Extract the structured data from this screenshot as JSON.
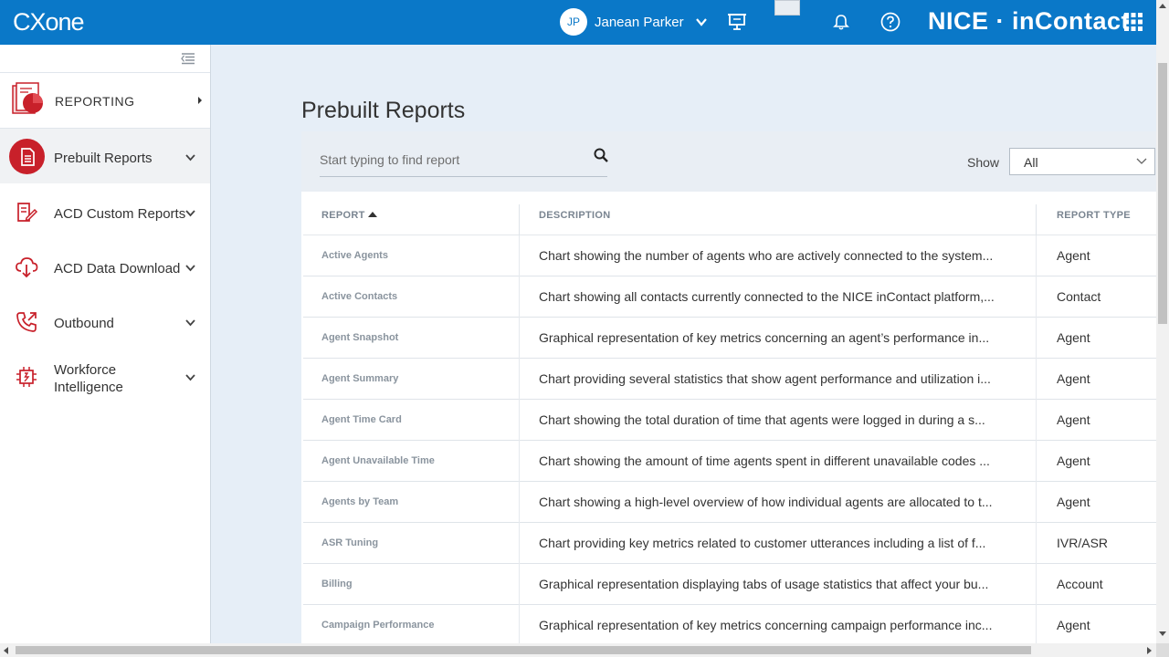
{
  "header": {
    "logo": "CXone",
    "user_initials": "JP",
    "user_name": "Janean Parker",
    "brand": "NICE · inContact",
    "icons": [
      "presentation-icon",
      "notification-bell-icon",
      "help-icon",
      "app-grid-icon"
    ]
  },
  "sidebar": {
    "module": "REPORTING",
    "items": [
      {
        "label": "Prebuilt Reports",
        "icon": "document-icon",
        "active": true
      },
      {
        "label": "ACD Custom Reports",
        "icon": "edit-document-icon"
      },
      {
        "label": "ACD Data Download",
        "icon": "cloud-download-icon"
      },
      {
        "label": "Outbound",
        "icon": "phone-outgoing-icon"
      },
      {
        "label": "Workforce Intelligence",
        "icon": "chip-icon"
      }
    ]
  },
  "main": {
    "title": "Prebuilt Reports",
    "search_placeholder": "Start typing to find report",
    "show_label": "Show",
    "show_value": "All",
    "columns": [
      "REPORT",
      "DESCRIPTION",
      "REPORT TYPE"
    ],
    "rows": [
      {
        "name": "Active Agents",
        "description": "Chart showing the number of agents who are actively connected to the system...",
        "type": "Agent"
      },
      {
        "name": "Active Contacts",
        "description": "Chart showing all contacts currently connected to the NICE inContact platform,...",
        "type": "Contact"
      },
      {
        "name": "Agent Snapshot",
        "description": "Graphical representation of key metrics concerning an agent’s performance in...",
        "type": "Agent"
      },
      {
        "name": "Agent Summary",
        "description": "Chart providing several statistics that show agent performance and utilization i...",
        "type": "Agent"
      },
      {
        "name": "Agent Time Card",
        "description": "Chart showing the total duration of time that agents were logged in during a s...",
        "type": "Agent"
      },
      {
        "name": "Agent Unavailable Time",
        "description": "Chart showing the amount of time agents spent in different unavailable codes ...",
        "type": "Agent"
      },
      {
        "name": "Agents by Team",
        "description": "Chart showing a high-level overview of how individual agents are allocated to t...",
        "type": "Agent"
      },
      {
        "name": "ASR Tuning",
        "description": "Chart providing key metrics related to customer utterances including a list of f...",
        "type": "IVR/ASR"
      },
      {
        "name": "Billing",
        "description": "Graphical representation displaying tabs of usage statistics that affect your bu...",
        "type": "Account"
      },
      {
        "name": "Campaign Performance",
        "description": "Graphical representation of key metrics concerning campaign performance inc...",
        "type": "Agent"
      }
    ]
  },
  "colors": {
    "header_blue": "#0a78c8",
    "accent_red": "#c8202a",
    "page_bg": "#e6eef7"
  }
}
